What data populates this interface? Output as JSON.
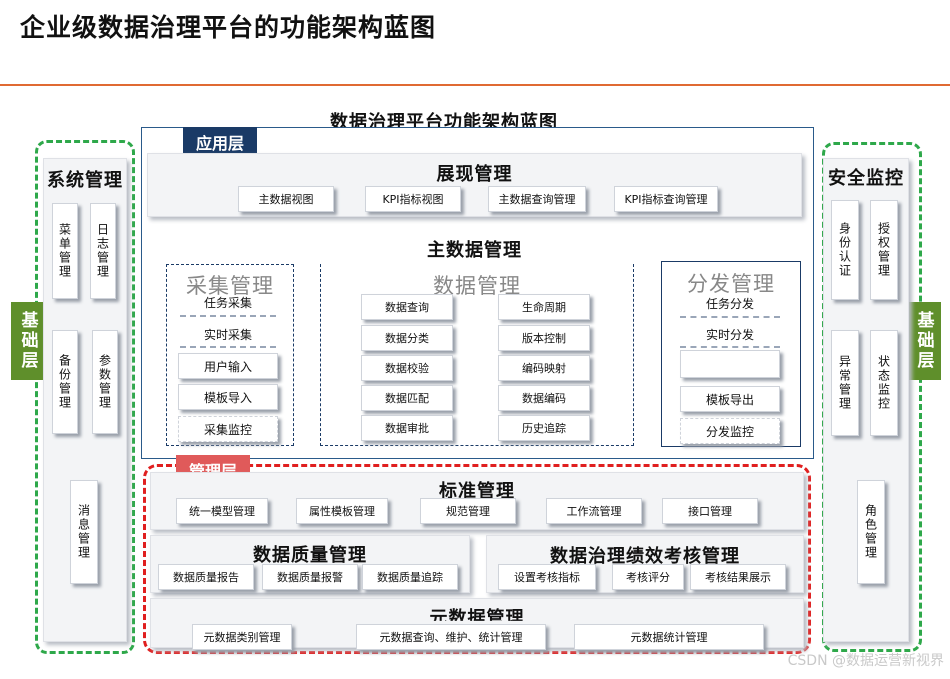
{
  "page": {
    "title": "企业级数据治理平台的功能架构蓝图"
  },
  "diagram": {
    "title": "数据治理平台功能架构蓝图",
    "left_base": "基础层",
    "right_base": "基础层",
    "system_mgmt": {
      "title": "系统管理",
      "items": [
        "菜单管理",
        "日志管理",
        "备份管理",
        "参数管理",
        "消息管理"
      ]
    },
    "security": {
      "title": "安全监控",
      "items": [
        "身份认证",
        "授权管理",
        "异常管理",
        "状态监控",
        "角色管理"
      ]
    },
    "app_layer": {
      "tag": "应用层",
      "display": {
        "title": "展现管理",
        "items": [
          "主数据视图",
          "KPI指标视图",
          "主数据查询管理",
          "KPI指标查询管理"
        ]
      },
      "master": {
        "title": "主数据管理",
        "collect": {
          "title": "采集管理",
          "items": [
            "任务采集",
            "实时采集",
            "用户输入",
            "模板导入",
            "采集监控"
          ]
        },
        "data": {
          "title": "数据管理",
          "col1": [
            "数据查询",
            "数据分类",
            "数据校验",
            "数据匹配",
            "数据审批"
          ],
          "col2": [
            "生命周期",
            "版本控制",
            "编码映射",
            "数据编码",
            "历史追踪"
          ]
        },
        "dist": {
          "title": "分发管理",
          "items": [
            "任务分发",
            "实时分发",
            "",
            "模板导出",
            "分发监控"
          ]
        }
      }
    },
    "mgmt_layer": {
      "tag": "管理层",
      "standard": {
        "title": "标准管理",
        "items": [
          "统一模型管理",
          "属性模板管理",
          "规范管理",
          "工作流管理",
          "接口管理"
        ]
      },
      "quality": {
        "title": "数据质量管理",
        "items": [
          "数据质量报告",
          "数据质量报警",
          "数据质量追踪"
        ]
      },
      "perf": {
        "title": "数据治理绩效考核管理",
        "items": [
          "设置考核指标",
          "考核评分",
          "考核结果展示"
        ]
      },
      "meta": {
        "title": "元数据管理",
        "items": [
          "元数据类别管理",
          "元数据查询、维护、统计管理",
          "元数据统计管理"
        ]
      }
    },
    "colors": {
      "app_tag": "#1a3a66",
      "mgmt_tag": "#e05a5a",
      "base_tag": "#5f8f2b",
      "green_dash": "#2ea84a",
      "red_dash": "#e01f1f"
    }
  },
  "watermark": "CSDN @数据运营新视界"
}
